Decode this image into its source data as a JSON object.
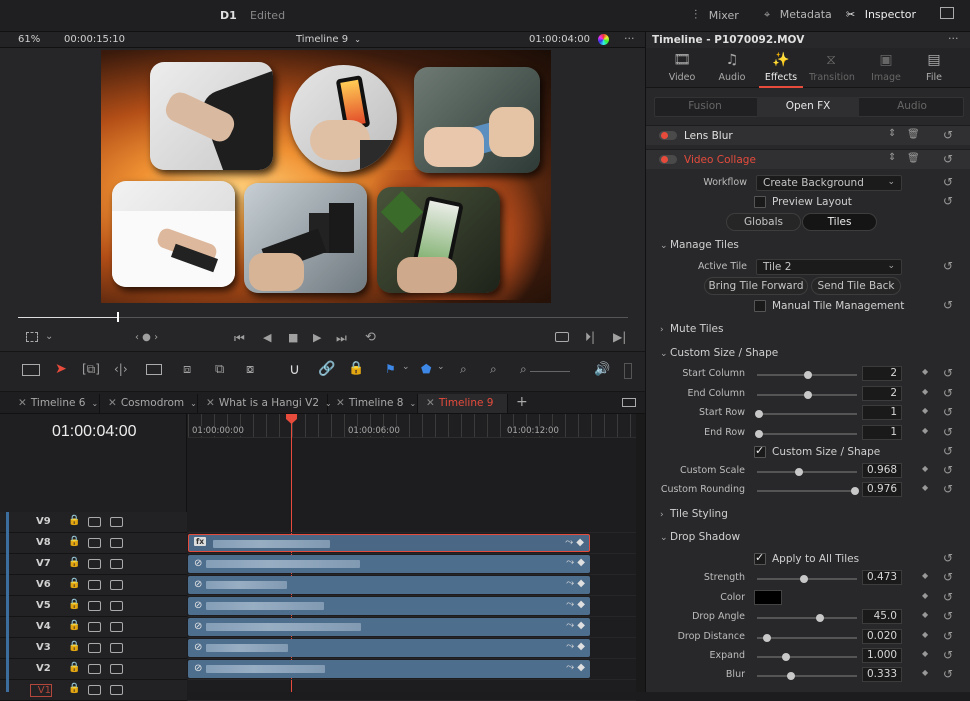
{
  "topbar": {
    "project": "D1",
    "status": "Edited",
    "mixer": "Mixer",
    "metadata": "Metadata",
    "inspector": "Inspector"
  },
  "viewer": {
    "zoom": "61%",
    "duration": "00:00:15:10",
    "timeline_name": "Timeline 9",
    "timecode": "01:00:04:00",
    "playhead_fraction": 0.28
  },
  "timeline_tabs": [
    "Timeline 6",
    "Cosmodrom",
    "What is a Hangi V2",
    "Timeline 8",
    "Timeline 9"
  ],
  "timeline": {
    "current_timecode": "01:00:04:00",
    "ruler": [
      "01:00:00:00",
      "01:00:06:00",
      "01:00:12:00"
    ],
    "tracks": [
      {
        "name": "V9",
        "has_clip": false
      },
      {
        "name": "V8",
        "has_clip": true,
        "fx": true
      },
      {
        "name": "V7",
        "has_clip": true
      },
      {
        "name": "V6",
        "has_clip": true
      },
      {
        "name": "V5",
        "has_clip": true
      },
      {
        "name": "V4",
        "has_clip": true
      },
      {
        "name": "V3",
        "has_clip": true
      },
      {
        "name": "V2",
        "has_clip": true
      },
      {
        "name": "V1",
        "has_clip": false
      }
    ],
    "clip_badge": "fx"
  },
  "inspector": {
    "title": "Timeline - P1070092.MOV",
    "tabs": [
      {
        "label": "Video",
        "icon": "film-icon"
      },
      {
        "label": "Audio",
        "icon": "music-icon"
      },
      {
        "label": "Effects",
        "icon": "magic-wand-icon"
      },
      {
        "label": "Transition",
        "icon": "transition-icon"
      },
      {
        "label": "Image",
        "icon": "image-icon"
      },
      {
        "label": "File",
        "icon": "file-icon"
      }
    ],
    "subtabs": [
      "Fusion",
      "Open FX",
      "Audio"
    ],
    "effects": [
      "Lens Blur",
      "Video Collage"
    ],
    "workflow_label": "Workflow",
    "workflow_value": "Create Background",
    "preview_layout": "Preview Layout",
    "globals": "Globals",
    "tiles": "Tiles",
    "manage_tiles": "Manage Tiles",
    "active_tile_label": "Active Tile",
    "active_tile_value": "Tile 2",
    "bring_forward": "Bring Tile Forward",
    "send_back": "Send Tile Back",
    "manual_tile": "Manual Tile Management",
    "mute_tiles": "Mute Tiles",
    "custom_size_section": "Custom Size / Shape",
    "start_column_label": "Start Column",
    "start_column": "2",
    "end_column_label": "End Column",
    "end_column": "2",
    "start_row_label": "Start Row",
    "start_row": "1",
    "end_row_label": "End Row",
    "end_row": "1",
    "custom_size_check": "Custom Size / Shape",
    "custom_scale_label": "Custom Scale",
    "custom_scale": "0.968",
    "custom_rounding_label": "Custom Rounding",
    "custom_rounding": "0.976",
    "tile_styling": "Tile Styling",
    "drop_shadow": "Drop Shadow",
    "apply_all": "Apply to All Tiles",
    "strength_label": "Strength",
    "strength": "0.473",
    "color_label": "Color",
    "shadow_color": "#000000",
    "drop_angle_label": "Drop Angle",
    "drop_angle": "45.0",
    "drop_distance_label": "Drop Distance",
    "drop_distance": "0.020",
    "expand_label": "Expand",
    "expand": "1.000",
    "blur_label": "Blur",
    "blur": "0.333"
  },
  "colors": {
    "accent_red": "#e64b3c",
    "clip_blue": "#4e6e8e"
  }
}
